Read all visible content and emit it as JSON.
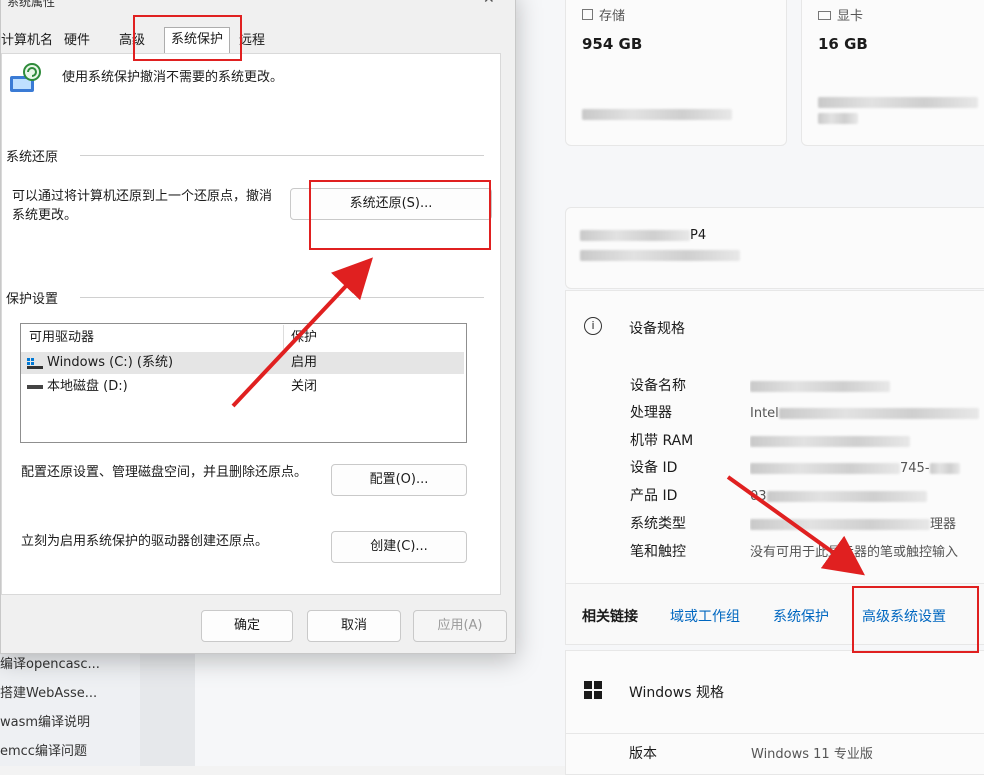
{
  "background": {
    "left_list": [
      "编译opencasc...",
      "搭建WebAsse...",
      "wasm编译说明",
      "emcc编译问题"
    ],
    "storage": {
      "title": "存储",
      "value": "954 GB"
    },
    "gpu": {
      "title": "显卡",
      "value": "16 GB"
    },
    "device_name_partial": "P4",
    "specs_header": "设备规格",
    "specs": [
      {
        "label": "设备名称",
        "value": ""
      },
      {
        "label": "处理器",
        "value": "Intel"
      },
      {
        "label": "机带 RAM",
        "value": ""
      },
      {
        "label": "设备 ID",
        "value": "745-"
      },
      {
        "label": "产品 ID",
        "value": "03"
      },
      {
        "label": "系统类型",
        "value": "理器"
      },
      {
        "label": "笔和触控",
        "value": "没有可用于此显示器的笔或触控输入"
      }
    ],
    "related_links": {
      "label": "相关链接",
      "links": [
        "域或工作组",
        "系统保护",
        "高级系统设置"
      ]
    },
    "windows_spec": {
      "title": "Windows 规格",
      "edition_label": "版本",
      "edition_value": "Windows 11 专业版"
    }
  },
  "dialog": {
    "title": "系统属性",
    "tabs": [
      "计算机名",
      "硬件",
      "高级",
      "系统保护",
      "远程"
    ],
    "active_tab": "系统保护",
    "intro": "使用系统保护撤消不需要的系统更改。",
    "restore_group": "系统还原",
    "restore_desc_1": "可以通过将计算机还原到上一个还原点，撤消",
    "restore_desc_2": "系统更改。",
    "restore_button": "系统还原(S)...",
    "protection_group": "保护设置",
    "table_headers": [
      "可用驱动器",
      "保护"
    ],
    "drives": [
      {
        "name": "Windows (C:) (系统)",
        "status": "启用"
      },
      {
        "name": "本地磁盘 (D:)",
        "status": "关闭"
      }
    ],
    "configure_desc": "配置还原设置、管理磁盘空间，并且删除还原点。",
    "configure_button": "配置(O)...",
    "create_desc": "立刻为启用系统保护的驱动器创建还原点。",
    "create_button": "创建(C)...",
    "ok_button": "确定",
    "cancel_button": "取消",
    "apply_button": "应用(A)"
  },
  "colors": {
    "accent": "#0067c0",
    "annotation": "#e02020"
  }
}
